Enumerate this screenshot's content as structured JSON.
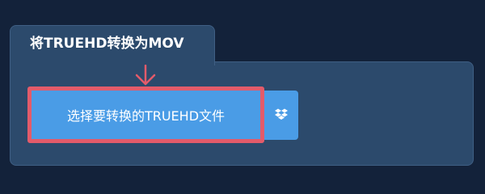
{
  "tab": {
    "title": "将TRUEHD转换为MOV"
  },
  "upload": {
    "label": "选择要转换的TRUEHD文件"
  },
  "icons": {
    "arrow": "arrow-down-icon",
    "dropbox": "dropbox-icon"
  },
  "colors": {
    "background": "#13223a",
    "panel": "#2c4a6c",
    "button": "#4a9ce6",
    "highlight": "#e35b6a"
  }
}
